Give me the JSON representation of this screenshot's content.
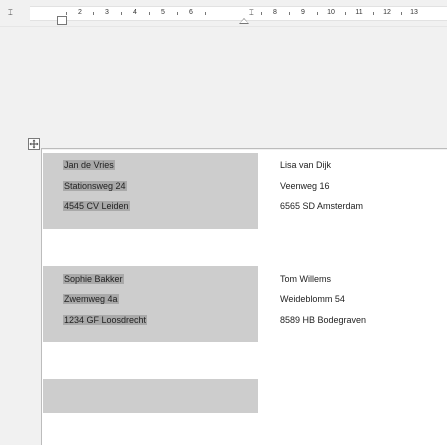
{
  "ruler": {
    "numbers": [
      "2",
      "3",
      "4",
      "5",
      "6",
      "8",
      "9",
      "10",
      "11",
      "12",
      "13"
    ],
    "leading_glyph": "⌶",
    "marker_glyph": "⌶"
  },
  "labels": [
    {
      "lines": [
        "Jan de Vries",
        "Stationsweg 24",
        "4545 CV Leiden"
      ]
    },
    {
      "lines": [
        "Lisa van Dijk",
        "Veenweg 16",
        "6565 SD Amsterdam"
      ]
    },
    {
      "lines": [
        "Sophie Bakker",
        "Zwemweg 4a",
        "1234 GF Loosdrecht"
      ]
    },
    {
      "lines": [
        "Tom Willems",
        "Weideblomm 54",
        "8589 HB Bodegraven"
      ]
    }
  ],
  "colors": {
    "selection": "#a9a9a9",
    "label_fill": "#cdcdcd",
    "canvas": "#f1f1f1"
  }
}
